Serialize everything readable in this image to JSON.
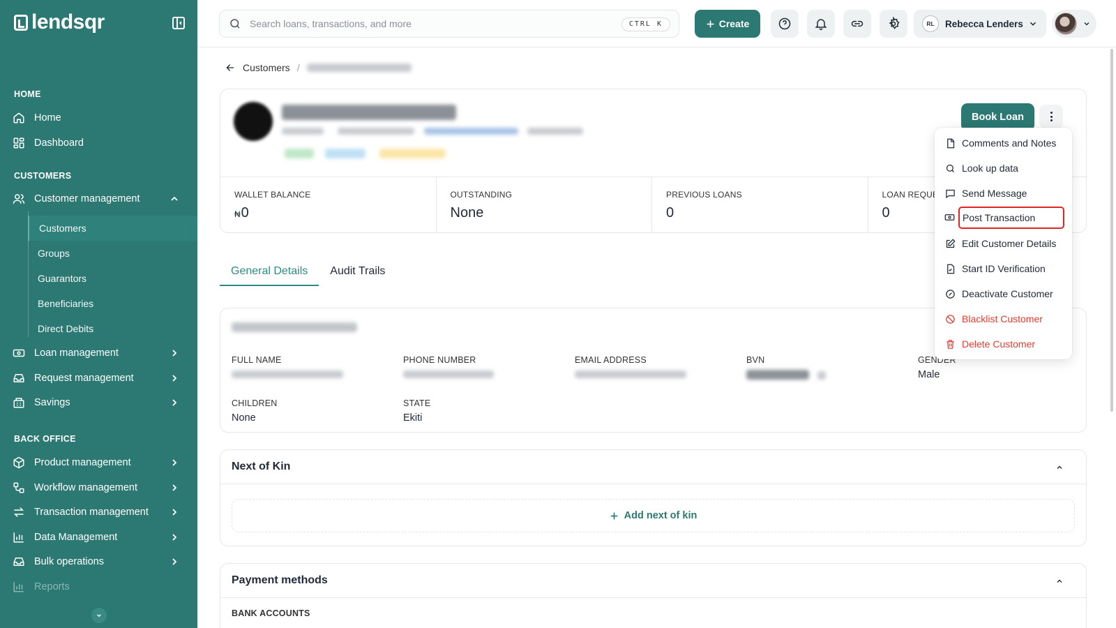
{
  "app": {
    "logo_text": "lendsqr"
  },
  "sidebar": {
    "sections": {
      "home": "HOME",
      "customers": "CUSTOMERS",
      "back_office": "BACK OFFICE"
    },
    "items": {
      "home": "Home",
      "dashboard": "Dashboard",
      "customer_management": "Customer management",
      "loan_management": "Loan management",
      "request_management": "Request management",
      "savings": "Savings",
      "product_management": "Product management",
      "workflow_management": "Workflow management",
      "transaction_management": "Transaction management",
      "data_management": "Data Management",
      "bulk_operations": "Bulk operations",
      "reports": "Reports"
    },
    "subitems": [
      "Customers",
      "Groups",
      "Guarantors",
      "Beneficiaries",
      "Direct Debits"
    ]
  },
  "topbar": {
    "search_placeholder": "Search loans, transactions, and more",
    "shortcut": "CTRL K",
    "create_label": "Create",
    "user_initials": "RL",
    "user_name": "Rebecca Lenders"
  },
  "breadcrumb": {
    "parent": "Customers",
    "separator": "/"
  },
  "profile": {
    "book_loan_label": "Book Loan",
    "stats": [
      {
        "label": "WALLET BALANCE",
        "currency": "₦",
        "value": "0"
      },
      {
        "label": "OUTSTANDING",
        "value": "None"
      },
      {
        "label": "PREVIOUS LOANS",
        "value": "0"
      },
      {
        "label": "LOAN REQUESTS",
        "value": "0"
      }
    ]
  },
  "tabs": [
    "General Details",
    "Audit Trails"
  ],
  "details": {
    "full_name_label": "FULL NAME",
    "phone_label": "PHONE NUMBER",
    "email_label": "EMAIL ADDRESS",
    "bvn_label": "BVN",
    "gender_label": "GENDER",
    "gender_value": "Male",
    "children_label": "CHILDREN",
    "children_value": "None",
    "state_label": "STATE",
    "state_value": "Ekiti"
  },
  "next_of_kin": {
    "title": "Next of Kin",
    "add_label": "Add next of kin"
  },
  "payment_methods": {
    "title": "Payment methods",
    "bank_accounts_label": "BANK ACCOUNTS"
  },
  "menu": {
    "items": [
      {
        "label": "Comments and Notes",
        "icon": "file-icon"
      },
      {
        "label": "Look up data",
        "icon": "search-icon"
      },
      {
        "label": "Send Message",
        "icon": "message-icon"
      },
      {
        "label": "Post Transaction",
        "icon": "cash-icon"
      },
      {
        "label": "Edit Customer Details",
        "icon": "edit-icon"
      },
      {
        "label": "Start ID Verification",
        "icon": "document-check-icon"
      },
      {
        "label": "Deactivate Customer",
        "icon": "circle-slash-icon"
      },
      {
        "label": "Blacklist Customer",
        "icon": "ban-icon"
      },
      {
        "label": "Delete Customer",
        "icon": "trash-icon"
      }
    ]
  },
  "colors": {
    "brand": "#2c7873",
    "danger": "#e03c31",
    "highlight_border": "#e02424"
  }
}
